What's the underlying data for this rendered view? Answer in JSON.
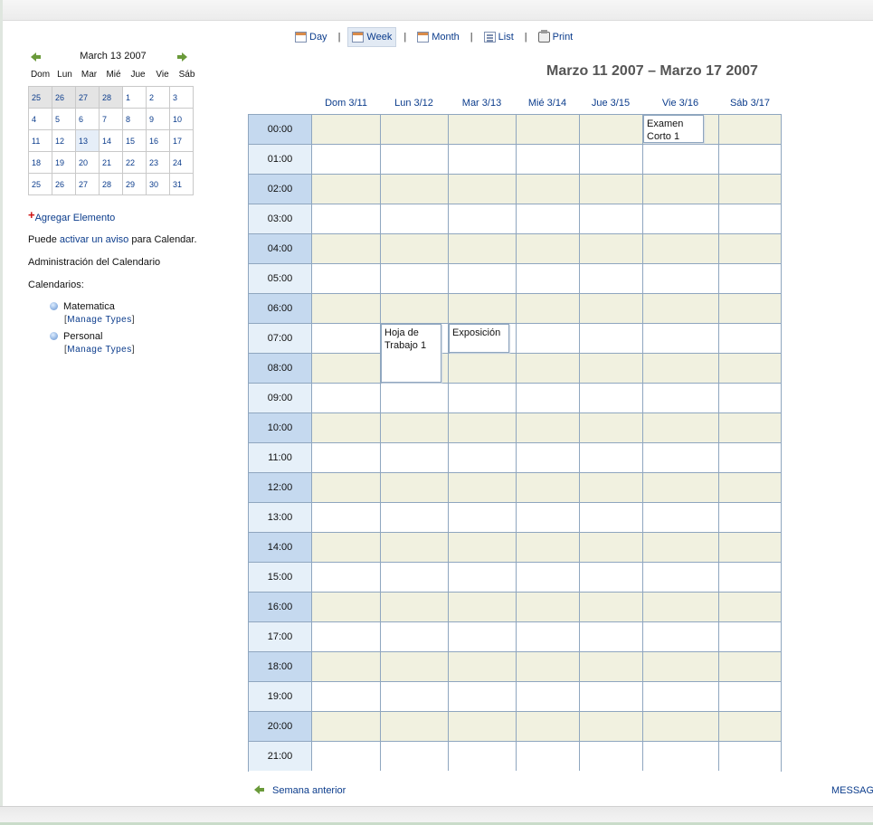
{
  "toolbar": {
    "day": "Day",
    "week": "Week",
    "month": "Month",
    "list": "List",
    "print": "Print",
    "separator": "|"
  },
  "mini_calendar": {
    "title": "March 13 2007",
    "dow": [
      "Dom",
      "Lun",
      "Mar",
      "Mié",
      "Jue",
      "Vie",
      "Sáb"
    ],
    "weeks": [
      [
        "25",
        "26",
        "27",
        "28",
        "1",
        "2",
        "3"
      ],
      [
        "4",
        "5",
        "6",
        "7",
        "8",
        "9",
        "10"
      ],
      [
        "11",
        "12",
        "13",
        "14",
        "15",
        "16",
        "17"
      ],
      [
        "18",
        "19",
        "20",
        "21",
        "22",
        "23",
        "24"
      ],
      [
        "25",
        "26",
        "27",
        "28",
        "29",
        "30",
        "31"
      ]
    ]
  },
  "sidebar": {
    "add_item": "Agregar Elemento",
    "notice_prefix": "Puede ",
    "notice_link": "activar un aviso",
    "notice_suffix": " para Calendar.",
    "admin_link": "Administración del Calendario",
    "calendars_label": "Calendarios:",
    "calendars": [
      {
        "name": "Matematica",
        "manage": "Manage Types"
      },
      {
        "name": "Personal",
        "manage": "Manage Types"
      }
    ]
  },
  "week": {
    "title": "Marzo 11 2007 – Marzo 17 2007",
    "days": [
      "Dom 3/11",
      "Lun 3/12",
      "Mar 3/13",
      "Mié 3/14",
      "Jue 3/15",
      "Vie 3/16",
      "Sáb 3/17"
    ],
    "hours": [
      "00:00",
      "01:00",
      "02:00",
      "03:00",
      "04:00",
      "05:00",
      "06:00",
      "07:00",
      "08:00",
      "09:00",
      "10:00",
      "11:00",
      "12:00",
      "13:00",
      "14:00",
      "15:00",
      "16:00",
      "17:00",
      "18:00",
      "19:00",
      "20:00",
      "21:00"
    ],
    "events": [
      {
        "title": "Examen Corto 1",
        "day": "Vie 3/16",
        "start": "00:00",
        "end": "01:00"
      },
      {
        "title": "Hoja de Trabajo 1",
        "day": "Lun 3/12",
        "start": "07:00",
        "end": "09:00"
      },
      {
        "title": "Exposición",
        "day": "Mar 3/13",
        "start": "07:00",
        "end": "08:00"
      }
    ]
  },
  "footer": {
    "prev_week": "Semana anterior",
    "messages": "MESSAGES"
  }
}
